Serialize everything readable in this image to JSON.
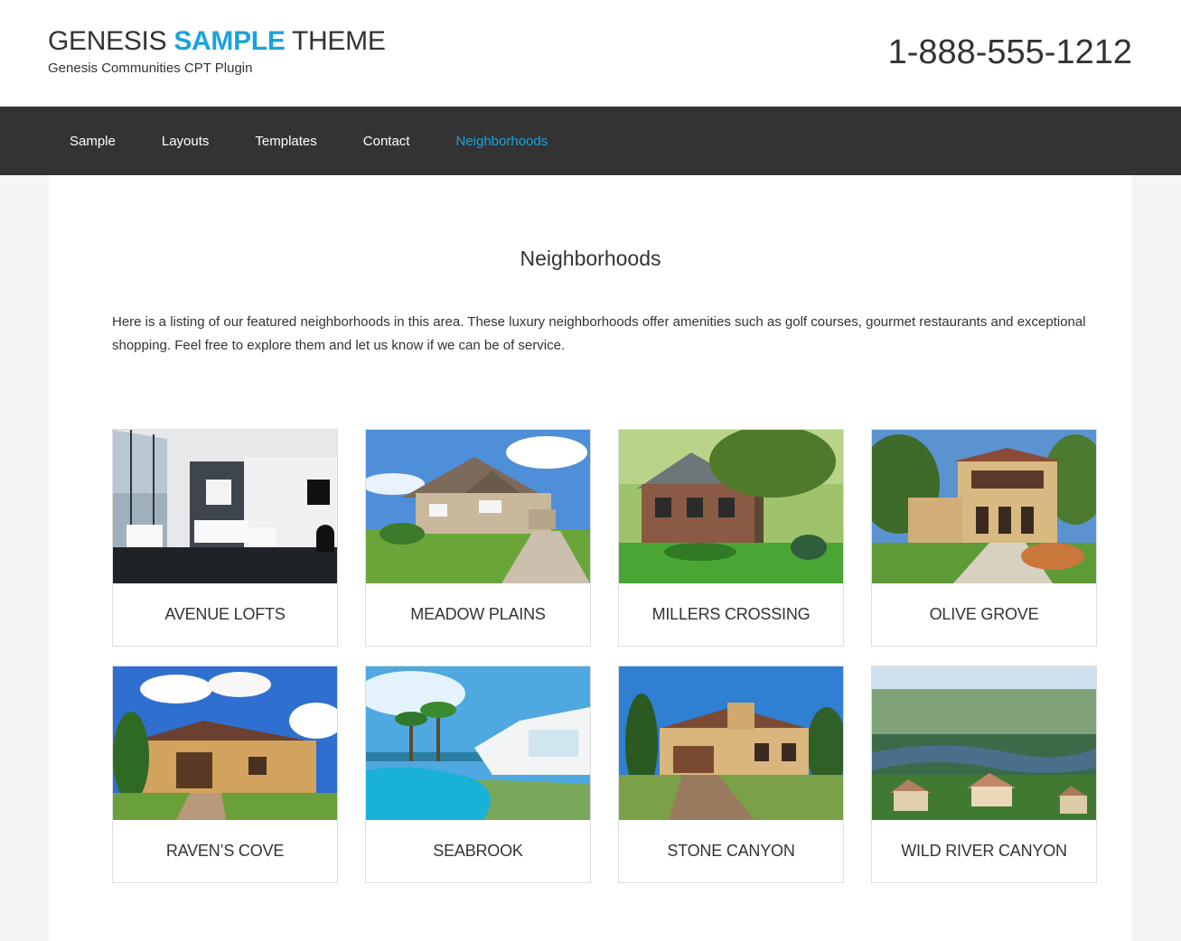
{
  "header": {
    "title_part1": "GENESIS ",
    "title_highlight": "SAMPLE",
    "title_part2": " THEME",
    "tagline": "Genesis Communities CPT Plugin",
    "phone": "1-888-555-1212"
  },
  "nav": {
    "items": [
      {
        "label": "Sample"
      },
      {
        "label": "Layouts"
      },
      {
        "label": "Templates"
      },
      {
        "label": "Contact"
      },
      {
        "label": "Neighborhoods",
        "active": true
      }
    ]
  },
  "main": {
    "title": "Neighborhoods",
    "intro": "Here is a listing of our featured neighborhoods in this area. These luxury neighborhoods offer amenities such as golf courses, gourmet restaurants and exceptional shopping. Feel free to explore them and let us know if we can be of service.",
    "neighborhoods": [
      {
        "name": "AVENUE LOFTS"
      },
      {
        "name": "MEADOW PLAINS"
      },
      {
        "name": "MILLERS CROSSING"
      },
      {
        "name": "OLIVE GROVE"
      },
      {
        "name": "RAVEN’S COVE"
      },
      {
        "name": "SEABROOK"
      },
      {
        "name": "STONE CANYON"
      },
      {
        "name": "WILD RIVER CANYON"
      }
    ]
  },
  "colors": {
    "accent": "#1ba2de",
    "nav_bg": "#333333",
    "page_bg": "#f5f5f5"
  }
}
